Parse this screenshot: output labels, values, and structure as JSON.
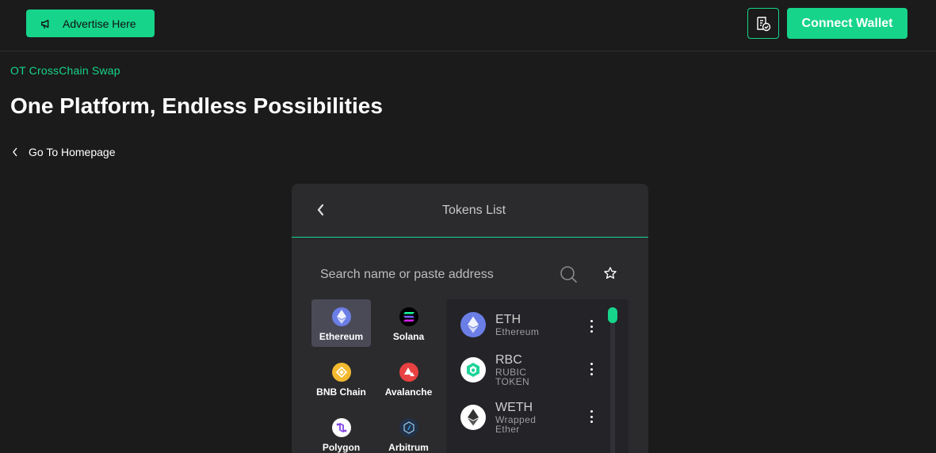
{
  "header": {
    "advertise_label": "Advertise Here",
    "connect_label": "Connect Wallet"
  },
  "hero": {
    "eyebrow": "OT CrossChain Swap",
    "title": "One Platform, Endless Possibilities",
    "back_link": "Go To Homepage"
  },
  "panel": {
    "title": "Tokens List",
    "search_placeholder": "Search name or paste address",
    "chains": [
      {
        "label": "Ethereum",
        "icon": "ethereum-icon",
        "active": true
      },
      {
        "label": "Solana",
        "icon": "solana-icon",
        "active": false
      },
      {
        "label": "BNB Chain",
        "icon": "bnb-icon",
        "active": false
      },
      {
        "label": "Avalanche",
        "icon": "avalanche-icon",
        "active": false
      },
      {
        "label": "Polygon",
        "icon": "polygon-icon",
        "active": false
      },
      {
        "label": "Arbitrum",
        "icon": "arbitrum-icon",
        "active": false
      }
    ],
    "tokens": [
      {
        "symbol": "ETH",
        "name_lines": [
          "Ethereum"
        ],
        "icon": "eth-token-icon"
      },
      {
        "symbol": "RBC",
        "name_lines": [
          "RUBIC",
          "TOKEN"
        ],
        "icon": "rbc-token-icon"
      },
      {
        "symbol": "WETH",
        "name_lines": [
          "Wrapped",
          "Ether"
        ],
        "icon": "weth-token-icon"
      }
    ]
  },
  "colors": {
    "accent": "#17d48b",
    "background": "#1b1b1b",
    "panel": "#2b2b2d"
  }
}
